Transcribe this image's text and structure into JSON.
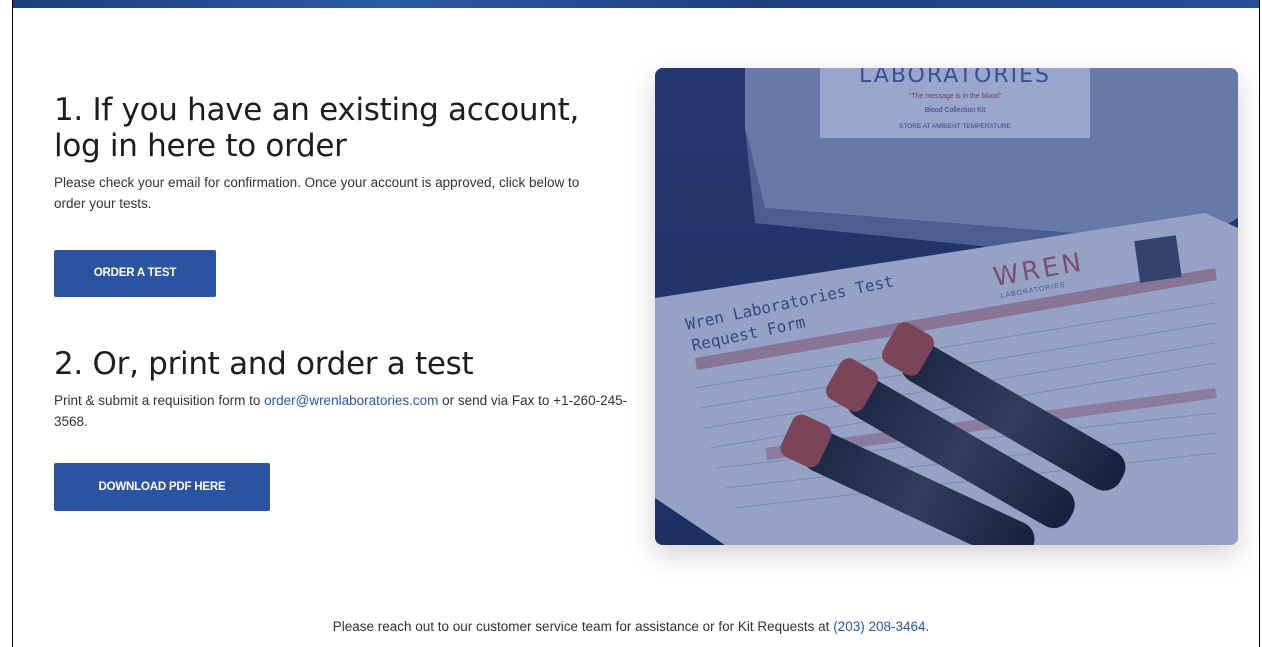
{
  "section1": {
    "heading": "1. If you have an existing account, log in here to order",
    "description": "Please check your email for confirmation. Once your account is approved, click below to order your tests.",
    "button_label": "ORDER A TEST"
  },
  "section2": {
    "heading": "2. Or, print and order a test",
    "description_before": "Print & submit a requisition form to ",
    "email": "order@wrenlaboratories.com",
    "description_after": " or send via Fax to +1-260-245-3568.",
    "button_label": "DOWNLOAD PDF HERE"
  },
  "photo": {
    "box_brand": "LABORATORIES",
    "box_tagline": "\"The message is in the blood\"",
    "box_line2": "Blood Collection Kit",
    "box_line3": "STORE AT AMBIENT TEMPERATURE",
    "form_brand": "WREN",
    "form_brand_sub": "LABORATORIES",
    "form_title_line1": "Wren Laboratories Test",
    "form_title_line2": "Request Form"
  },
  "footer": {
    "text_before": "Please reach out to our customer service team for assistance or for Kit Requests at ",
    "phone": "(203) 208-3464",
    "text_after": "."
  },
  "colors": {
    "accent": "#2b53a1",
    "link": "#2a57a5",
    "tube_cap": "#a04a4a"
  }
}
